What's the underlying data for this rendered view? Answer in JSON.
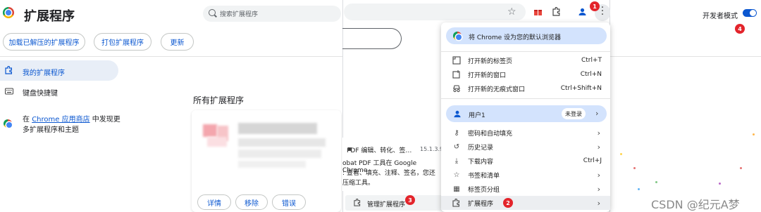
{
  "page": {
    "title": "扩展程序",
    "search_placeholder": "搜索扩展程序",
    "dev_mode_label": "开发者模式"
  },
  "toolbar": {
    "load_unpacked": "加载已解压的扩展程序",
    "pack": "打包扩展程序",
    "update": "更新"
  },
  "sidebar": {
    "items": [
      {
        "label": "我的扩展程序",
        "icon": "puzzle-icon",
        "selected": true
      },
      {
        "label": "键盘快捷键",
        "icon": "keyboard-icon",
        "selected": false
      }
    ],
    "promo_prefix": "在 ",
    "promo_link": "Chrome 应用商店",
    "promo_suffix": " 中发现更多扩展程序和主题"
  },
  "main": {
    "section_title": "所有扩展程序",
    "card_buttons": {
      "details": "详情",
      "remove": "移除",
      "errors": "错误"
    }
  },
  "ext_popup": {
    "line1": "PDF 编辑、转化、签…",
    "version": "15.1.3.9",
    "line2": "obat PDF 工具在 Google Chrome",
    "line3": ": 查看、填充、注释、签名，您还",
    "line4": "压缩工具。",
    "manage_label": "管理扩展程序"
  },
  "menu": {
    "set_default": "将 Chrome 设为您的默认浏览器",
    "items1": [
      {
        "label": "打开新的标签页",
        "shortcut": "Ctrl+T",
        "icon": "new-tab-icon"
      },
      {
        "label": "打开新的窗口",
        "shortcut": "Ctrl+N",
        "icon": "new-window-icon"
      },
      {
        "label": "打开新的无痕式窗口",
        "shortcut": "Ctrl+Shift+N",
        "icon": "incognito-icon"
      }
    ],
    "user_label": "用户1",
    "user_status": "未登录",
    "items2": [
      {
        "label": "密码和自动填充",
        "icon": "key-icon",
        "arrow": true
      },
      {
        "label": "历史记录",
        "icon": "history-icon",
        "arrow": true
      },
      {
        "label": "下载内容",
        "shortcut": "Ctrl+J",
        "icon": "download-icon"
      },
      {
        "label": "书签和清单",
        "icon": "star-icon",
        "arrow": true
      },
      {
        "label": "标签页分组",
        "icon": "grid-icon",
        "arrow": true
      },
      {
        "label": "扩展程序",
        "icon": "puzzle-icon",
        "arrow": true
      }
    ]
  },
  "badges": [
    "1",
    "2",
    "3",
    "4"
  ],
  "watermark": "CSDN @纪元A梦"
}
